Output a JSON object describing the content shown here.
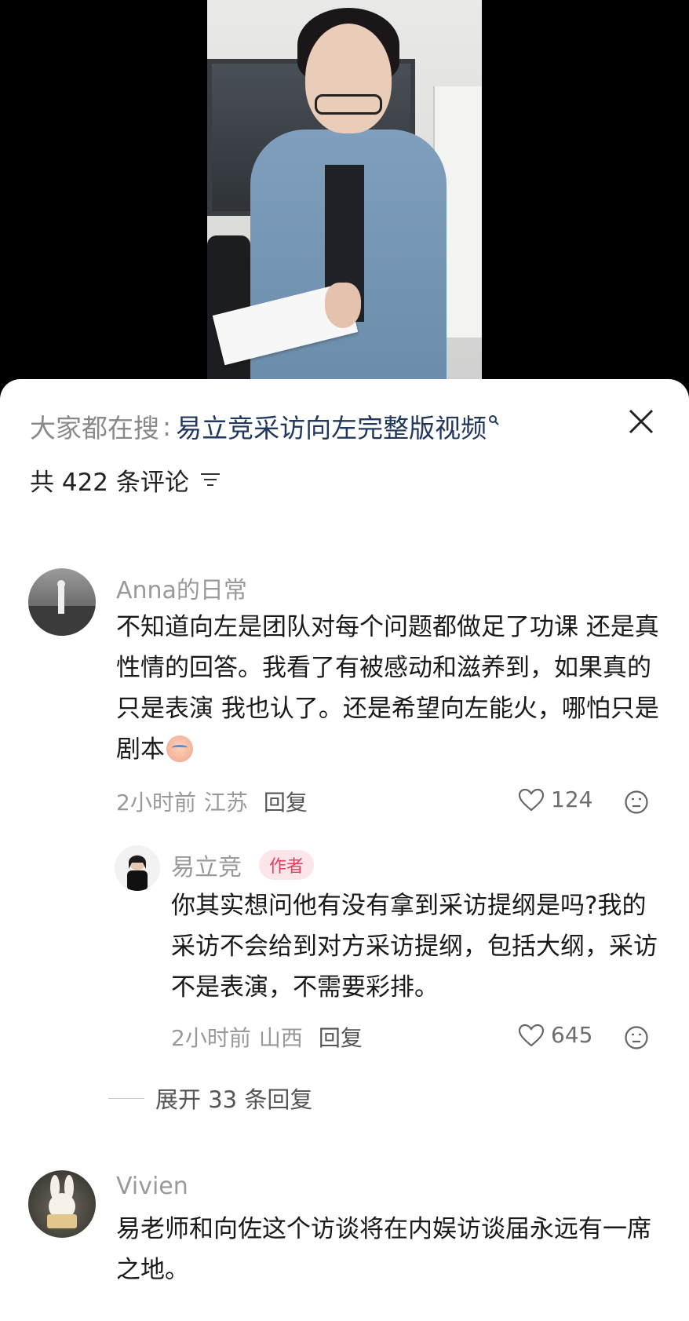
{
  "search": {
    "prefix": "大家都在搜",
    "separator": ":",
    "query": "易立竞采访向左完整版视频"
  },
  "comments_header": {
    "count_text": "共 422 条评论"
  },
  "comments": [
    {
      "username": "Anna的日常",
      "text": "不知道向左是团队对每个问题都做足了功课 还是真性情的回答。我看了有被感动和滋养到，如果真的只是表演 我也认了。还是希望向左能火，哪怕只是剧本",
      "time": "2小时前",
      "location": "江苏",
      "reply_label": "回复",
      "likes": "124",
      "reply": {
        "username": "易立竞",
        "badge": "作者",
        "text": "你其实想问他有没有拿到采访提纲是吗?我的采访不会给到对方采访提纲，包括大纲，采访不是表演，不需要彩排。",
        "time": "2小时前",
        "location": "山西",
        "reply_label": "回复",
        "likes": "645"
      },
      "expand_text": "展开 33 条回复"
    },
    {
      "username": "Vivien",
      "text": "易老师和向佐这个访谈将在内娱访谈届永远有一席之地。"
    }
  ],
  "icons": {
    "close": "close-icon",
    "search": "search-icon",
    "sort": "sort-icon",
    "like": "heart-icon",
    "dislike": "dislike-face-icon",
    "emoji": "crying-emoji-icon"
  },
  "colors": {
    "query": "#22375e",
    "badge_text": "#e0415c",
    "badge_bg": "#fde5ea",
    "muted": "#9a9a9a"
  }
}
